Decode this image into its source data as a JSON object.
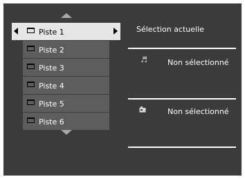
{
  "tracks": [
    {
      "label": "Piste 1"
    },
    {
      "label": "Piste 2"
    },
    {
      "label": "Piste 3"
    },
    {
      "label": "Piste 4"
    },
    {
      "label": "Piste 5"
    },
    {
      "label": "Piste 6"
    }
  ],
  "selected_index": 0,
  "panel": {
    "title": "Sélection actuelle",
    "audio_slot": {
      "icon": "music-note-icon",
      "status": "Non sélectionné"
    },
    "subtitle_slot": {
      "icon": "subtitle-icon",
      "status": "Non sélectionné"
    }
  },
  "colors": {
    "background": "#3b3b3b",
    "row": "#5d5d5d",
    "selected_row": "#e6e6e6",
    "text": "#ffffff"
  }
}
